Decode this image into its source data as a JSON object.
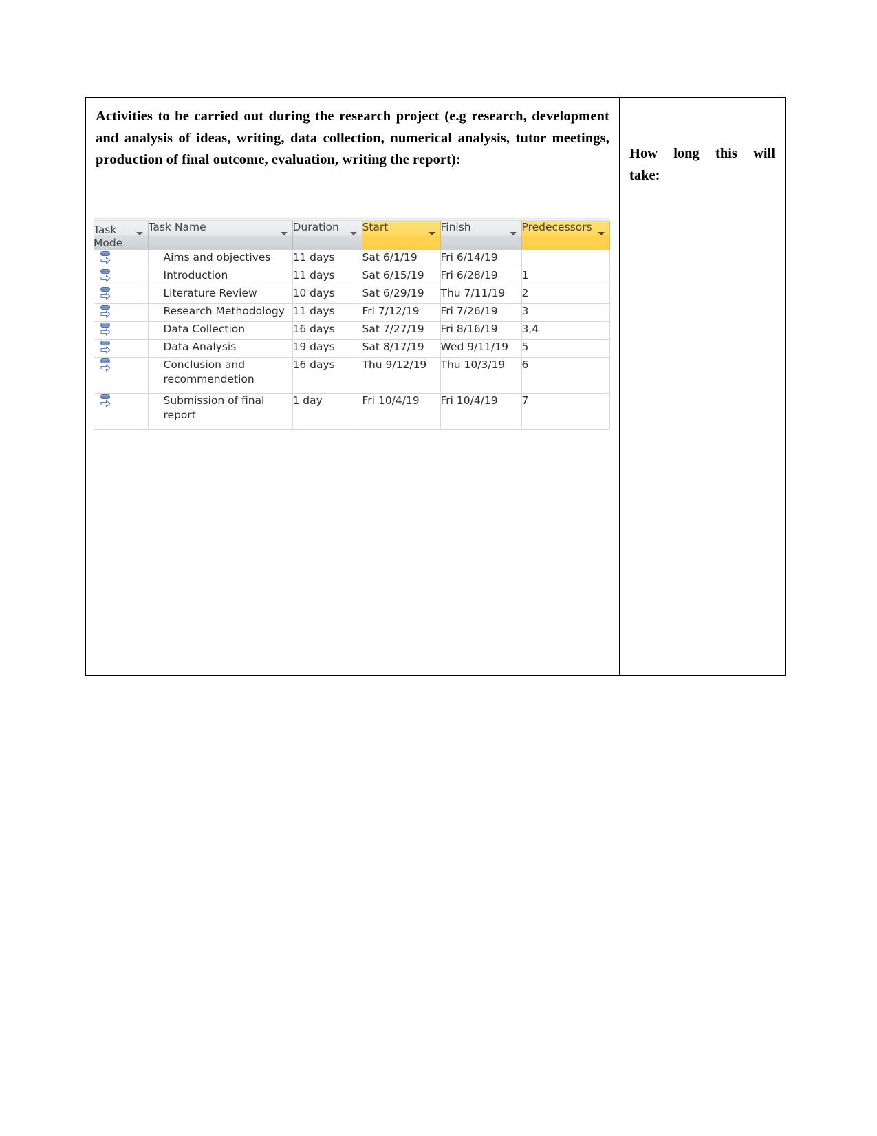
{
  "document": {
    "left_cell": {
      "prompt": "Activities to be carried out during the research project (e.g research, development and analysis of ideas, writing, data collection, numerical analysis, tutor meetings, production of final outcome, evaluation, writing the report):"
    },
    "right_cell": {
      "label_line1": "How long this will",
      "label_line2": "take:"
    }
  },
  "project_table": {
    "columns": [
      {
        "label": "Task Mode",
        "highlight": "gray",
        "has_filter": true
      },
      {
        "label": "Task Name",
        "highlight": "gray",
        "has_filter": true
      },
      {
        "label": "Duration",
        "highlight": "gray",
        "has_filter": true
      },
      {
        "label": "Start",
        "highlight": "yellow",
        "has_filter": true
      },
      {
        "label": "Finish",
        "highlight": "gray",
        "has_filter": true
      },
      {
        "label": "Predecessors",
        "highlight": "yellow",
        "has_filter": true
      }
    ],
    "accent_yellow": "#FFD95F",
    "accent_gray": "#DADDE0",
    "icon_blue": "#6F8FC4",
    "rows": [
      {
        "mode_icon": "auto-schedule-icon",
        "name": "Aims and objectives",
        "duration": "11 days",
        "start": "Sat 6/1/19",
        "finish": "Fri 6/14/19",
        "predecessors": ""
      },
      {
        "mode_icon": "auto-schedule-icon",
        "name": "Introduction",
        "duration": "11 days",
        "start": "Sat 6/15/19",
        "finish": "Fri 6/28/19",
        "predecessors": "1"
      },
      {
        "mode_icon": "auto-schedule-icon",
        "name": "Literature Review",
        "duration": "10 days",
        "start": "Sat 6/29/19",
        "finish": "Thu 7/11/19",
        "predecessors": "2"
      },
      {
        "mode_icon": "auto-schedule-icon",
        "name": "Research Methodology",
        "duration": "11 days",
        "start": "Fri 7/12/19",
        "finish": "Fri 7/26/19",
        "predecessors": "3"
      },
      {
        "mode_icon": "auto-schedule-icon",
        "name": "Data Collection",
        "duration": "16 days",
        "start": "Sat 7/27/19",
        "finish": "Fri 8/16/19",
        "predecessors": "3,4"
      },
      {
        "mode_icon": "auto-schedule-icon",
        "name": "Data Analysis",
        "duration": "19 days",
        "start": "Sat 8/17/19",
        "finish": "Wed 9/11/19",
        "predecessors": "5"
      },
      {
        "mode_icon": "auto-schedule-icon",
        "name": "Conclusion and recommendetion",
        "duration": "16 days",
        "start": "Thu 9/12/19",
        "finish": "Thu 10/3/19",
        "predecessors": "6"
      },
      {
        "mode_icon": "auto-schedule-icon",
        "name": "Submission of final report",
        "duration": "1 day",
        "start": "Fri 10/4/19",
        "finish": "Fri 10/4/19",
        "predecessors": "7"
      }
    ]
  }
}
